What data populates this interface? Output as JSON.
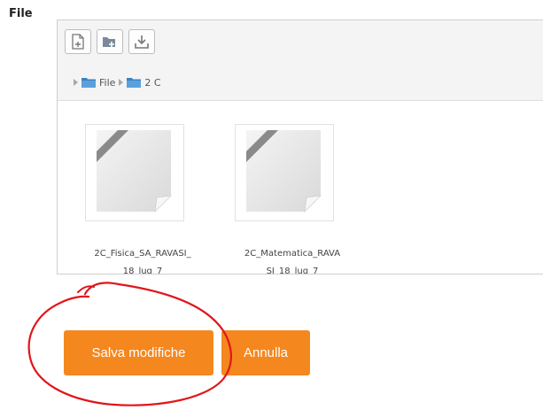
{
  "field": {
    "label": "File"
  },
  "toolbar": {
    "buttons": [
      {
        "icon": "add-file-icon",
        "title": "add-file"
      },
      {
        "icon": "create-folder-icon",
        "title": "create-folder"
      },
      {
        "icon": "download-icon",
        "title": "download"
      }
    ]
  },
  "breadcrumb": {
    "items": [
      "File",
      "2 C"
    ]
  },
  "files": [
    {
      "name_line1": "2C_Fisica_SA_RAVASI_",
      "name_line2": "18_lug_7"
    },
    {
      "name_line1": "2C_Matematica_RAVA",
      "name_line2": "SI_18_lug_7"
    }
  ],
  "actions": {
    "save_label": "Salva modifiche",
    "cancel_label": "Annulla"
  },
  "colors": {
    "button_orange": "#f5871f",
    "annotation_red": "#e0161b",
    "folder_blue": "#3a82c4"
  }
}
